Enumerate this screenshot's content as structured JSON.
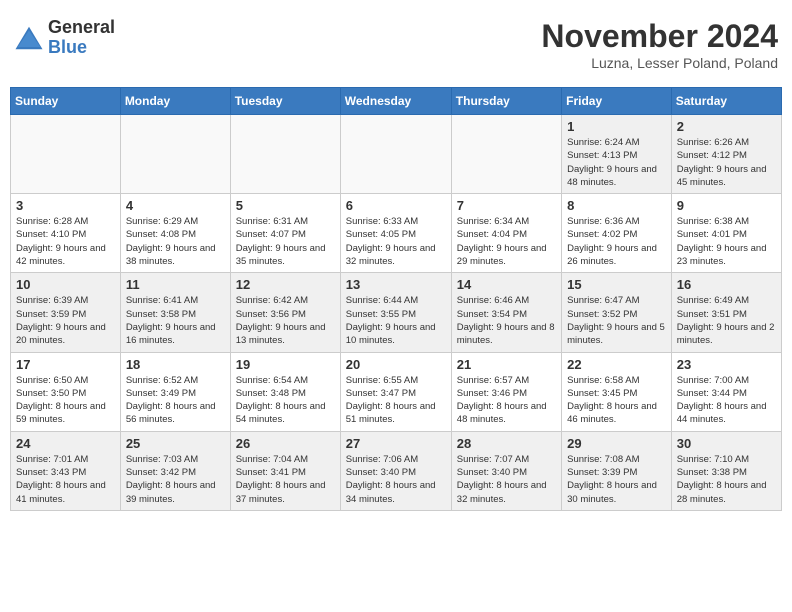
{
  "header": {
    "logo_general": "General",
    "logo_blue": "Blue",
    "month_title": "November 2024",
    "location": "Luzna, Lesser Poland, Poland"
  },
  "days_of_week": [
    "Sunday",
    "Monday",
    "Tuesday",
    "Wednesday",
    "Thursday",
    "Friday",
    "Saturday"
  ],
  "weeks": [
    [
      {
        "day": "",
        "info": ""
      },
      {
        "day": "",
        "info": ""
      },
      {
        "day": "",
        "info": ""
      },
      {
        "day": "",
        "info": ""
      },
      {
        "day": "",
        "info": ""
      },
      {
        "day": "1",
        "info": "Sunrise: 6:24 AM\nSunset: 4:13 PM\nDaylight: 9 hours\nand 48 minutes."
      },
      {
        "day": "2",
        "info": "Sunrise: 6:26 AM\nSunset: 4:12 PM\nDaylight: 9 hours\nand 45 minutes."
      }
    ],
    [
      {
        "day": "3",
        "info": "Sunrise: 6:28 AM\nSunset: 4:10 PM\nDaylight: 9 hours\nand 42 minutes."
      },
      {
        "day": "4",
        "info": "Sunrise: 6:29 AM\nSunset: 4:08 PM\nDaylight: 9 hours\nand 38 minutes."
      },
      {
        "day": "5",
        "info": "Sunrise: 6:31 AM\nSunset: 4:07 PM\nDaylight: 9 hours\nand 35 minutes."
      },
      {
        "day": "6",
        "info": "Sunrise: 6:33 AM\nSunset: 4:05 PM\nDaylight: 9 hours\nand 32 minutes."
      },
      {
        "day": "7",
        "info": "Sunrise: 6:34 AM\nSunset: 4:04 PM\nDaylight: 9 hours\nand 29 minutes."
      },
      {
        "day": "8",
        "info": "Sunrise: 6:36 AM\nSunset: 4:02 PM\nDaylight: 9 hours\nand 26 minutes."
      },
      {
        "day": "9",
        "info": "Sunrise: 6:38 AM\nSunset: 4:01 PM\nDaylight: 9 hours\nand 23 minutes."
      }
    ],
    [
      {
        "day": "10",
        "info": "Sunrise: 6:39 AM\nSunset: 3:59 PM\nDaylight: 9 hours\nand 20 minutes."
      },
      {
        "day": "11",
        "info": "Sunrise: 6:41 AM\nSunset: 3:58 PM\nDaylight: 9 hours\nand 16 minutes."
      },
      {
        "day": "12",
        "info": "Sunrise: 6:42 AM\nSunset: 3:56 PM\nDaylight: 9 hours\nand 13 minutes."
      },
      {
        "day": "13",
        "info": "Sunrise: 6:44 AM\nSunset: 3:55 PM\nDaylight: 9 hours\nand 10 minutes."
      },
      {
        "day": "14",
        "info": "Sunrise: 6:46 AM\nSunset: 3:54 PM\nDaylight: 9 hours\nand 8 minutes."
      },
      {
        "day": "15",
        "info": "Sunrise: 6:47 AM\nSunset: 3:52 PM\nDaylight: 9 hours\nand 5 minutes."
      },
      {
        "day": "16",
        "info": "Sunrise: 6:49 AM\nSunset: 3:51 PM\nDaylight: 9 hours\nand 2 minutes."
      }
    ],
    [
      {
        "day": "17",
        "info": "Sunrise: 6:50 AM\nSunset: 3:50 PM\nDaylight: 8 hours\nand 59 minutes."
      },
      {
        "day": "18",
        "info": "Sunrise: 6:52 AM\nSunset: 3:49 PM\nDaylight: 8 hours\nand 56 minutes."
      },
      {
        "day": "19",
        "info": "Sunrise: 6:54 AM\nSunset: 3:48 PM\nDaylight: 8 hours\nand 54 minutes."
      },
      {
        "day": "20",
        "info": "Sunrise: 6:55 AM\nSunset: 3:47 PM\nDaylight: 8 hours\nand 51 minutes."
      },
      {
        "day": "21",
        "info": "Sunrise: 6:57 AM\nSunset: 3:46 PM\nDaylight: 8 hours\nand 48 minutes."
      },
      {
        "day": "22",
        "info": "Sunrise: 6:58 AM\nSunset: 3:45 PM\nDaylight: 8 hours\nand 46 minutes."
      },
      {
        "day": "23",
        "info": "Sunrise: 7:00 AM\nSunset: 3:44 PM\nDaylight: 8 hours\nand 44 minutes."
      }
    ],
    [
      {
        "day": "24",
        "info": "Sunrise: 7:01 AM\nSunset: 3:43 PM\nDaylight: 8 hours\nand 41 minutes."
      },
      {
        "day": "25",
        "info": "Sunrise: 7:03 AM\nSunset: 3:42 PM\nDaylight: 8 hours\nand 39 minutes."
      },
      {
        "day": "26",
        "info": "Sunrise: 7:04 AM\nSunset: 3:41 PM\nDaylight: 8 hours\nand 37 minutes."
      },
      {
        "day": "27",
        "info": "Sunrise: 7:06 AM\nSunset: 3:40 PM\nDaylight: 8 hours\nand 34 minutes."
      },
      {
        "day": "28",
        "info": "Sunrise: 7:07 AM\nSunset: 3:40 PM\nDaylight: 8 hours\nand 32 minutes."
      },
      {
        "day": "29",
        "info": "Sunrise: 7:08 AM\nSunset: 3:39 PM\nDaylight: 8 hours\nand 30 minutes."
      },
      {
        "day": "30",
        "info": "Sunrise: 7:10 AM\nSunset: 3:38 PM\nDaylight: 8 hours\nand 28 minutes."
      }
    ]
  ]
}
